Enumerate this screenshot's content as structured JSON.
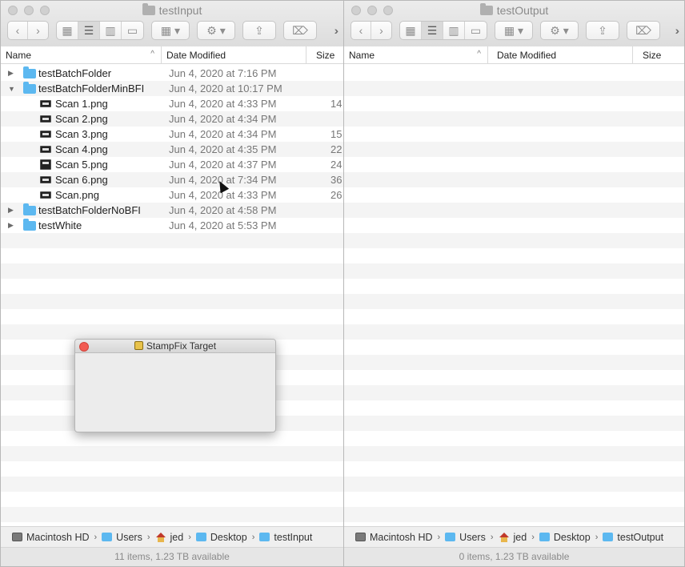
{
  "left_window": {
    "title": "testInput",
    "columns": {
      "name": "Name",
      "date": "Date Modified",
      "size": "Size"
    },
    "rows": [
      {
        "kind": "folder",
        "expanded": false,
        "level": 0,
        "name": "testBatchFolder",
        "date": "Jun 4, 2020 at 7:16 PM",
        "size": ""
      },
      {
        "kind": "folder",
        "expanded": true,
        "level": 0,
        "name": "testBatchFolderMinBFI",
        "date": "Jun 4, 2020 at 10:17 PM",
        "size": ""
      },
      {
        "kind": "file",
        "level": 1,
        "name": "Scan 1.png",
        "date": "Jun 4, 2020 at 4:33 PM",
        "size": "14"
      },
      {
        "kind": "file",
        "level": 1,
        "name": "Scan 2.png",
        "date": "Jun 4, 2020 at 4:34 PM",
        "size": ""
      },
      {
        "kind": "file",
        "level": 1,
        "name": "Scan 3.png",
        "date": "Jun 4, 2020 at 4:34 PM",
        "size": "15"
      },
      {
        "kind": "file",
        "level": 1,
        "name": "Scan 4.png",
        "date": "Jun 4, 2020 at 4:35 PM",
        "size": "22"
      },
      {
        "kind": "file",
        "level": 1,
        "name": "Scan 5.png",
        "date": "Jun 4, 2020 at 4:37 PM",
        "size": "24"
      },
      {
        "kind": "file",
        "level": 1,
        "name": "Scan 6.png",
        "date": "Jun 4, 2020 at 7:34 PM",
        "size": "36"
      },
      {
        "kind": "file",
        "level": 1,
        "name": "Scan.png",
        "date": "Jun 4, 2020 at 4:33 PM",
        "size": "26"
      },
      {
        "kind": "folder",
        "expanded": false,
        "level": 0,
        "name": "testBatchFolderNoBFI",
        "date": "Jun 4, 2020 at 4:58 PM",
        "size": ""
      },
      {
        "kind": "folder",
        "expanded": false,
        "level": 0,
        "name": "testWhite",
        "date": "Jun 4, 2020 at 5:53 PM",
        "size": ""
      }
    ],
    "path": [
      {
        "icon": "hard-drive-icon",
        "label": "Macintosh HD"
      },
      {
        "icon": "users-folder-icon",
        "label": "Users"
      },
      {
        "icon": "home-icon",
        "label": "jed"
      },
      {
        "icon": "folder-icon",
        "label": "Desktop"
      },
      {
        "icon": "folder-icon",
        "label": "testInput"
      }
    ],
    "status": "11 items, 1.23 TB available"
  },
  "right_window": {
    "title": "testOutput",
    "columns": {
      "name": "Name",
      "date": "Date Modified",
      "size": "Size"
    },
    "rows": [],
    "path": [
      {
        "icon": "hard-drive-icon",
        "label": "Macintosh HD"
      },
      {
        "icon": "users-folder-icon",
        "label": "Users"
      },
      {
        "icon": "home-icon",
        "label": "jed"
      },
      {
        "icon": "folder-icon",
        "label": "Desktop"
      },
      {
        "icon": "folder-icon",
        "label": "testOutput"
      }
    ],
    "status": "0 items, 1.23 TB available"
  },
  "stamp_window": {
    "title": "StampFix Target"
  },
  "icons": {
    "back": "chevron-left-icon",
    "forward": "chevron-right-icon",
    "view_icons": "grid-icon",
    "view_list": "list-icon",
    "view_columns": "columns-icon",
    "view_gallery": "gallery-icon",
    "group": "group-icon",
    "action": "gear-icon",
    "share": "share-icon",
    "tags": "tag-icon",
    "more": "double-chevron-icon"
  },
  "colors": {
    "folder": "#5cb8f0",
    "close_red": "#f25b52",
    "text_gray": "#777777"
  }
}
